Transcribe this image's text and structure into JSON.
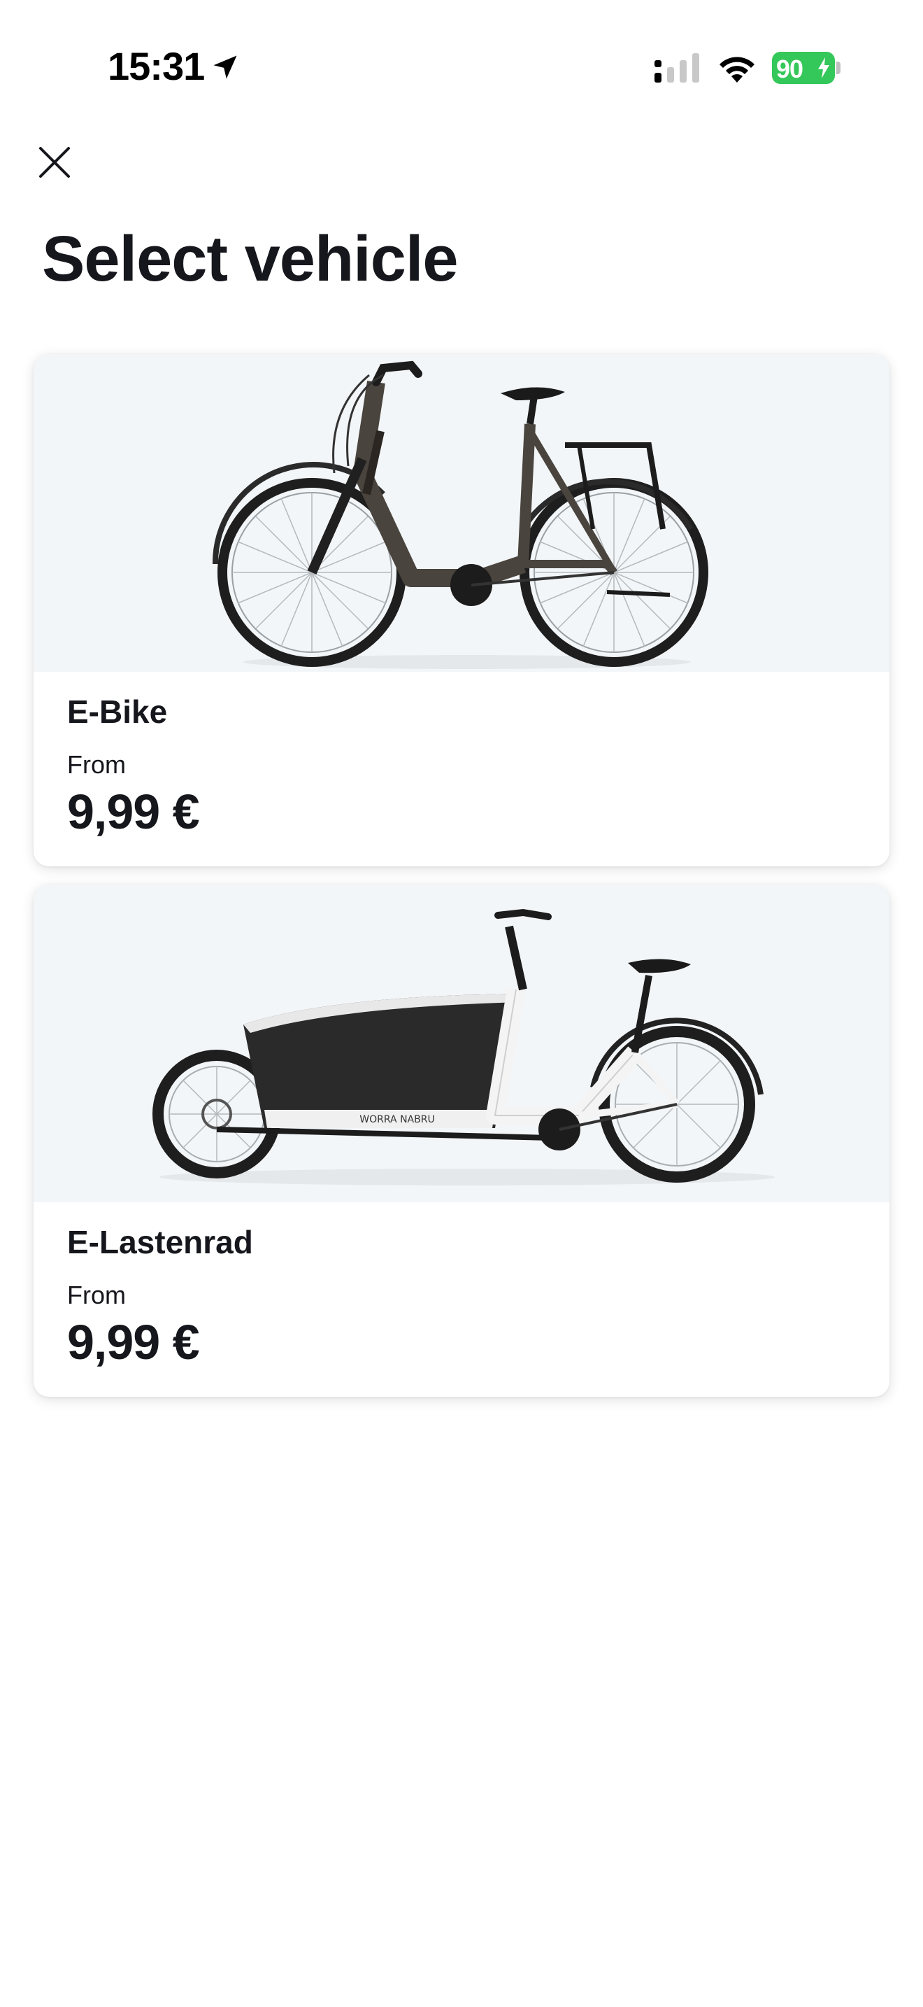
{
  "status_bar": {
    "time": "15:31",
    "battery_percent": "90",
    "icons": [
      "location-arrow-icon",
      "cellular-signal-icon",
      "wifi-icon",
      "battery-charging-icon"
    ],
    "battery_color": "#34c759"
  },
  "header": {
    "close_icon": "close-icon",
    "title": "Select vehicle"
  },
  "vehicles": [
    {
      "name": "E-Bike",
      "price_label": "From",
      "price": "9,99 €",
      "image": "e-bike-image"
    },
    {
      "name": "E-Lastenrad",
      "price_label": "From",
      "price": "9,99 €",
      "image": "cargo-bike-image"
    }
  ],
  "colors": {
    "text": "#16171c",
    "card_image_bg": "#f3f6f8",
    "background": "#ffffff"
  }
}
